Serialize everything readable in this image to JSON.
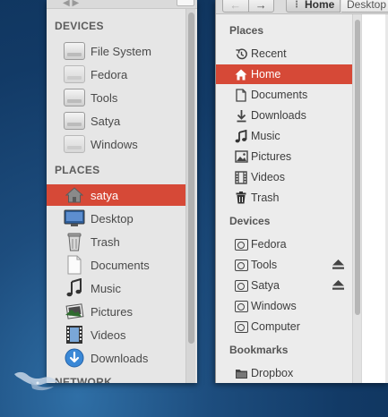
{
  "left_window": {
    "sections": {
      "devices": "DEVICES",
      "places": "PLACES",
      "network": "NETWORK"
    },
    "devices": [
      {
        "label": "File System",
        "icon": "drive-icon"
      },
      {
        "label": "Fedora",
        "icon": "drive-icon"
      },
      {
        "label": "Tools",
        "icon": "drive-icon"
      },
      {
        "label": "Satya",
        "icon": "drive-icon"
      },
      {
        "label": "Windows",
        "icon": "drive-icon"
      }
    ],
    "places": [
      {
        "label": "satya",
        "icon": "home-icon",
        "selected": true
      },
      {
        "label": "Desktop",
        "icon": "desktop-icon"
      },
      {
        "label": "Trash",
        "icon": "trash-icon"
      },
      {
        "label": "Documents",
        "icon": "document-icon"
      },
      {
        "label": "Music",
        "icon": "music-icon"
      },
      {
        "label": "Pictures",
        "icon": "pictures-icon"
      },
      {
        "label": "Videos",
        "icon": "videos-icon"
      },
      {
        "label": "Downloads",
        "icon": "downloads-icon"
      }
    ]
  },
  "right_window": {
    "breadcrumb": {
      "home": "Home",
      "next": "Desktop"
    },
    "sections": {
      "places": "Places",
      "devices": "Devices",
      "bookmarks": "Bookmarks"
    },
    "places": [
      {
        "label": "Recent",
        "icon": "recent-icon"
      },
      {
        "label": "Home",
        "icon": "home-icon",
        "selected": true
      },
      {
        "label": "Documents",
        "icon": "document-icon"
      },
      {
        "label": "Downloads",
        "icon": "downloads-icon"
      },
      {
        "label": "Music",
        "icon": "music-icon"
      },
      {
        "label": "Pictures",
        "icon": "pictures-icon"
      },
      {
        "label": "Videos",
        "icon": "videos-icon"
      },
      {
        "label": "Trash",
        "icon": "trash-icon"
      }
    ],
    "devices": [
      {
        "label": "Fedora",
        "icon": "drive-icon"
      },
      {
        "label": "Tools",
        "icon": "drive-icon",
        "eject": true
      },
      {
        "label": "Satya",
        "icon": "drive-icon",
        "eject": true
      },
      {
        "label": "Windows",
        "icon": "drive-icon"
      },
      {
        "label": "Computer",
        "icon": "drive-icon"
      }
    ],
    "bookmarks": [
      {
        "label": "Dropbox",
        "icon": "folder-icon"
      }
    ]
  },
  "colors": {
    "selection": "#d64937",
    "desktop_bg": "#123a66"
  }
}
